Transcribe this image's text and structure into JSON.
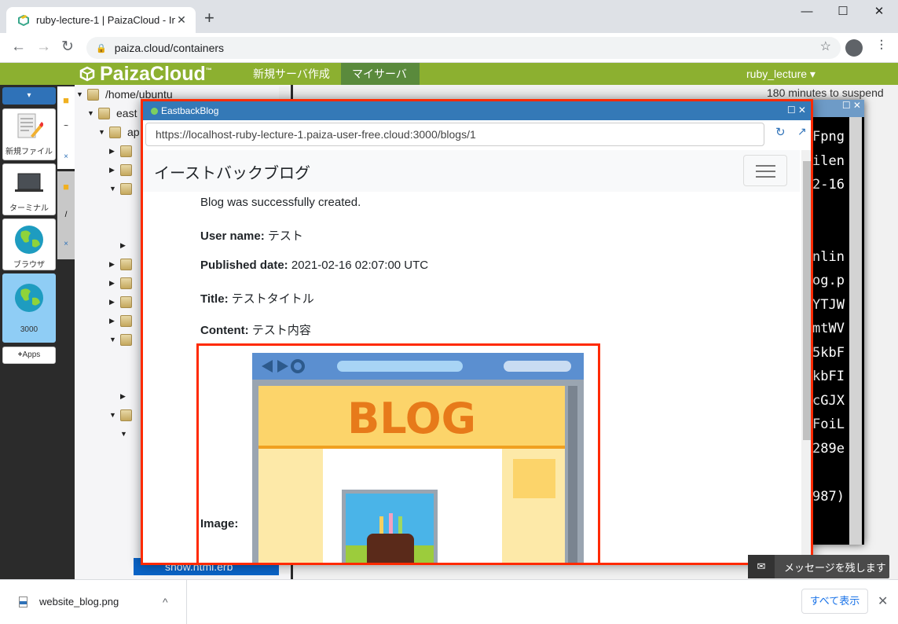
{
  "chrome": {
    "tab_title": "ruby-lecture-1 | PaizaCloud - Inst",
    "tab_close": "✕",
    "new_tab": "+",
    "url": "paiza.cloud/containers",
    "window_controls": {
      "minimize": "—",
      "maximize": "☐",
      "close": "✕"
    },
    "back_icon": "←",
    "forward_icon": "→",
    "reload_icon": "↻",
    "star_icon": "☆",
    "menu_icon": "⋮"
  },
  "header": {
    "logo": "PaizaCloud",
    "logo_tm": "™",
    "nav": [
      "新規サーバ作成",
      "マイサーバ"
    ],
    "user": "ruby_lecture ▾",
    "accent": "#8cb030"
  },
  "sidebar": {
    "app_menu": "▾",
    "buttons": [
      {
        "label": "新規ファイル",
        "icon": "new-file-icon"
      },
      {
        "label": "ターミナル",
        "icon": "terminal-icon"
      },
      {
        "label": "ブラウザ",
        "icon": "browser-icon"
      },
      {
        "label": "3000",
        "icon": "browser-icon"
      }
    ],
    "apps_label": "Apps"
  },
  "vtabs": {
    "tab1_label": "~",
    "tab1_close": "×",
    "tab2_label": "/",
    "tab2_close": "×"
  },
  "filetree": {
    "rows": [
      "/home/ubuntu",
      "east",
      "ap",
      "",
      "",
      "",
      "",
      "",
      "",
      "",
      "",
      "",
      "",
      ""
    ],
    "bottom_file": "show.html.erb"
  },
  "ide": {
    "suspend": "180 minutes to suspend",
    "terminal_lines": [
      "Fpng",
      "ilen",
      "2-16",
      "",
      "",
      "nlin",
      "og.p",
      "YTJW",
      "mtWV",
      "5kbF",
      "kbFI",
      "cGJX",
      "FoiL",
      "289e",
      "",
      "987)"
    ]
  },
  "popup": {
    "title": "EastbackBlog",
    "controls": "☐  ✕",
    "url": "https://localhost-ruby-lecture-1.paiza-user-free.cloud:3000/blogs/1",
    "reload": "↻",
    "open_external": "↗"
  },
  "blog": {
    "brand": "イーストバックブログ",
    "notice": "Blog was successfully created.",
    "fields": [
      {
        "label": "User name:",
        "value": "テスト"
      },
      {
        "label": "Published date:",
        "value": "2021-02-16 02:07:00 UTC"
      },
      {
        "label": "Title:",
        "value": "テストタイトル"
      },
      {
        "label": "Content:",
        "value": "テスト内容"
      }
    ],
    "image_label": "Image:",
    "image_text": "BLOG"
  },
  "download_bar": {
    "file": "website_blog.png",
    "chevron": "^",
    "show_all": "すべて表示",
    "close": "✕"
  },
  "message_button": "メッセージを残します"
}
